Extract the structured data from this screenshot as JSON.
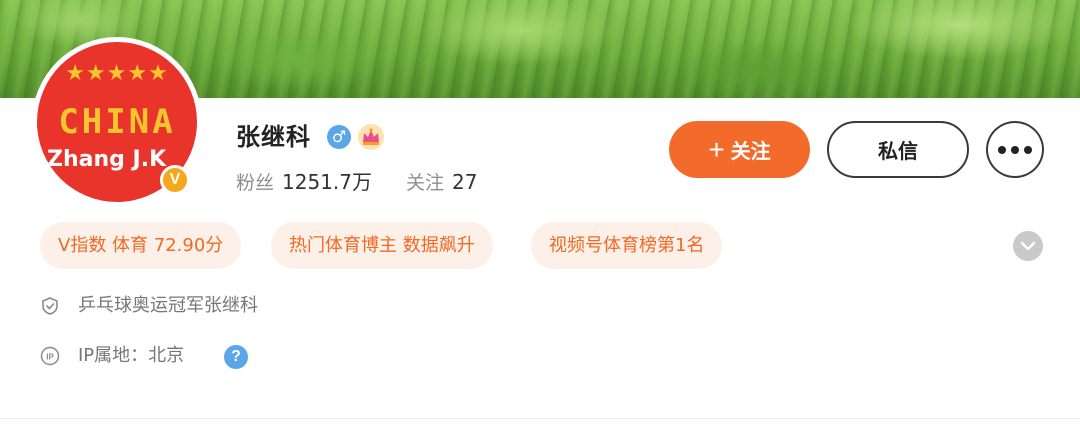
{
  "profile": {
    "name": "张继科",
    "gender_symbol": "♂",
    "avatar": {
      "stars": "★★★★★",
      "line1": "CHINA",
      "line2": "Zhang J.K",
      "verified_badge": "V"
    },
    "stats": {
      "fans_label": "粉丝",
      "fans_value": "1251.7万",
      "following_label": "关注",
      "following_value": "27"
    }
  },
  "actions": {
    "follow_icon": "+",
    "follow_label": "关注",
    "message_label": "私信",
    "more_icon": "more-dots-icon"
  },
  "tags": [
    "V指数 体育 72.90分",
    "热门体育博主 数据飙升",
    "视频号体育榜第1名"
  ],
  "info": {
    "verification": "乒乓球奥运冠军张继科",
    "ip_location": "IP属地：北京",
    "help_symbol": "?"
  },
  "colors": {
    "accent": "#f26b2a",
    "tag_bg": "#fdf0e8",
    "tag_text": "#f06a24",
    "avatar_bg": "#e8342b",
    "avatar_gold": "#f5c530",
    "verified_badge": "#f7a71b",
    "gender_blue": "#5aa6e6"
  }
}
